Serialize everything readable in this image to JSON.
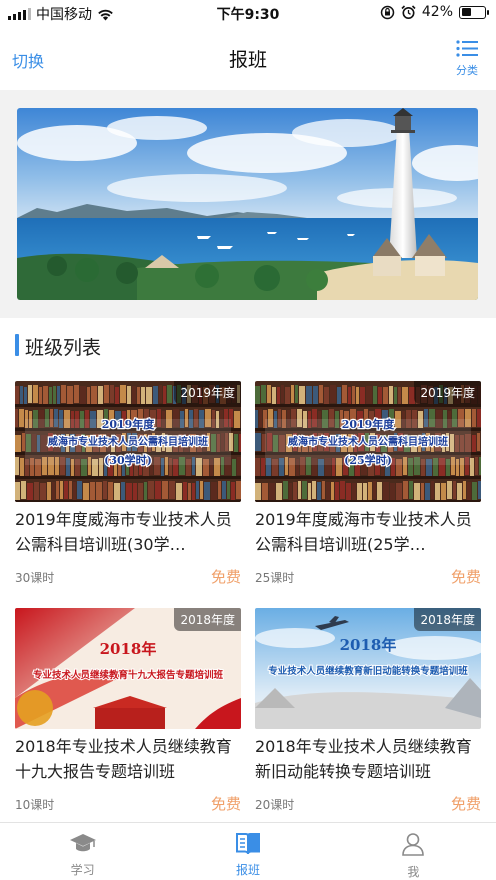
{
  "status_bar": {
    "carrier": "中国移动",
    "time": "下午9:30",
    "battery": "42%",
    "battery_level": 0.42
  },
  "nav": {
    "switch_label": "切换",
    "title": "报班",
    "category_label": "分类"
  },
  "section": {
    "title": "班级列表"
  },
  "courses": [
    {
      "year_badge": "2019年度",
      "thumb_year": "2019年度",
      "thumb_title": "威海市专业技术人员公需科目培训班",
      "thumb_hours": "(30学时)",
      "title": "2019年度威海市专业技术人员公需科目培训班(30学…",
      "hours": "30课时",
      "price": "免费"
    },
    {
      "year_badge": "2019年度",
      "thumb_year": "2019年度",
      "thumb_title": "威海市专业技术人员公需科目培训班",
      "thumb_hours": "(25学时)",
      "title": "2019年度威海市专业技术人员公需科目培训班(25学…",
      "hours": "25课时",
      "price": "免费"
    },
    {
      "year_badge": "2018年度",
      "thumb_year": "2018年",
      "thumb_title": "专业技术人员继续教育十九大报告专题培训班",
      "title": "2018年专业技术人员继续教育十九大报告专题培训班",
      "hours": "10课时",
      "price": "免费"
    },
    {
      "year_badge": "2018年度",
      "thumb_year": "2018年",
      "thumb_title": "专业技术人员继续教育新旧动能转换专题培训班",
      "title": "2018年专业技术人员继续教育新旧动能转换专题培训班",
      "hours": "20课时",
      "price": "免费"
    }
  ],
  "tabbar": {
    "items": [
      {
        "label": "学习",
        "icon": "graduation-cap-icon"
      },
      {
        "label": "报班",
        "icon": "book-icon",
        "active": true
      },
      {
        "label": "我",
        "icon": "person-icon"
      }
    ]
  },
  "colors": {
    "accent": "#3a8ee6",
    "price": "#f0a06a"
  }
}
